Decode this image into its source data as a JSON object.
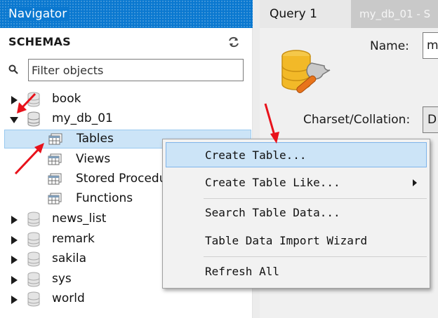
{
  "navigator": {
    "title": "Navigator",
    "section_title": "SCHEMAS",
    "filter_placeholder": "Filter objects",
    "schemas": [
      {
        "name": "book",
        "expanded": false
      },
      {
        "name": "my_db_01",
        "expanded": true,
        "children": [
          "Tables",
          "Views",
          "Stored Procedures",
          "Functions"
        ]
      },
      {
        "name": "news_list",
        "expanded": false
      },
      {
        "name": "remark",
        "expanded": false
      },
      {
        "name": "sakila",
        "expanded": false
      },
      {
        "name": "sys",
        "expanded": false
      },
      {
        "name": "world",
        "expanded": false
      }
    ],
    "selected_item": "Tables"
  },
  "tabs": {
    "active": "Query 1",
    "inactive": "my_db_01 - S"
  },
  "editor": {
    "name_label": "Name:",
    "name_value": "m",
    "charset_label": "Charset/Collation:",
    "charset_value": "D"
  },
  "context_menu": {
    "items": [
      {
        "label": "Create Table...",
        "highlighted": true,
        "has_submenu": false
      },
      {
        "label": "Create Table Like...",
        "highlighted": false,
        "has_submenu": true
      },
      {
        "label": "Search Table Data...",
        "highlighted": false,
        "has_submenu": false
      },
      {
        "label": "Table Data Import Wizard",
        "highlighted": false,
        "has_submenu": false
      },
      {
        "label": "Refresh All",
        "highlighted": false,
        "has_submenu": false
      }
    ]
  },
  "colors": {
    "header_blue": "#0a78d0",
    "selection": "#cce4f7",
    "annotation_red": "#e8121b"
  }
}
